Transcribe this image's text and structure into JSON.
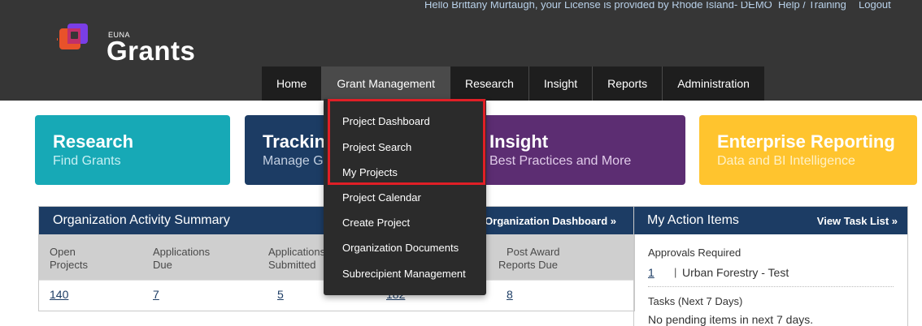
{
  "header": {
    "greeting": "Hello Brittany Murtaugh, your License is provided by Rhode Island- DEMO",
    "help_link": "Help / Training",
    "logout_link": "Logout",
    "logo": {
      "small_text": "EUNA",
      "large_text": "Grants"
    }
  },
  "nav": {
    "items": [
      "Home",
      "Grant Management",
      "Research",
      "Insight",
      "Reports",
      "Administration"
    ],
    "active": "Grant Management"
  },
  "dropdown": {
    "items": [
      "Project Dashboard",
      "Project Search",
      "My Projects",
      "Project Calendar",
      "Create Project",
      "Organization Documents",
      "Subrecipient Management"
    ],
    "highlighted_items": [
      "Project Dashboard",
      "Project Search",
      "My Projects"
    ]
  },
  "tiles": {
    "research": {
      "title": "Research",
      "subtitle": "Find Grants"
    },
    "tracking": {
      "title": "Tracking",
      "subtitle": "Manage Grants"
    },
    "insight": {
      "title": "Insight",
      "subtitle": "Best Practices and More"
    },
    "enterprise": {
      "title": "Enterprise Reporting",
      "subtitle": "Data and BI Intelligence"
    }
  },
  "org_summary": {
    "title": "Organization Activity Summary",
    "link": "View Organization Dashboard »",
    "link_visible": "v Organization Dashboard »",
    "columns": [
      {
        "line1": "Open",
        "line2": "Projects",
        "value": "140"
      },
      {
        "line1": "Applications",
        "line2": "Due",
        "value": "7"
      },
      {
        "line1": "Applications",
        "line2": "Submitted",
        "value": "5"
      },
      {
        "line1": "",
        "line2": "",
        "value": "182"
      },
      {
        "line1": "Post Award",
        "line2": "Reports Due",
        "value": "8"
      }
    ]
  },
  "action_items": {
    "title": "My Action Items",
    "link": "View Task List »",
    "approvals_label": "Approvals Required",
    "approvals_count": "1",
    "approvals_item": "Urban Forestry - Test",
    "tasks_label": "Tasks (Next 7 Days)",
    "tasks_empty": "No pending items in next 7 days."
  },
  "colors": {
    "header_bg": "#363636",
    "nav_bg": "#1e1e1e",
    "nav_active": "#4a4a4a",
    "navy": "#1c3c64",
    "teal": "#17a9b6",
    "purple": "#5c2d72",
    "yellow": "#ffc42e",
    "highlight": "#e01f26"
  }
}
